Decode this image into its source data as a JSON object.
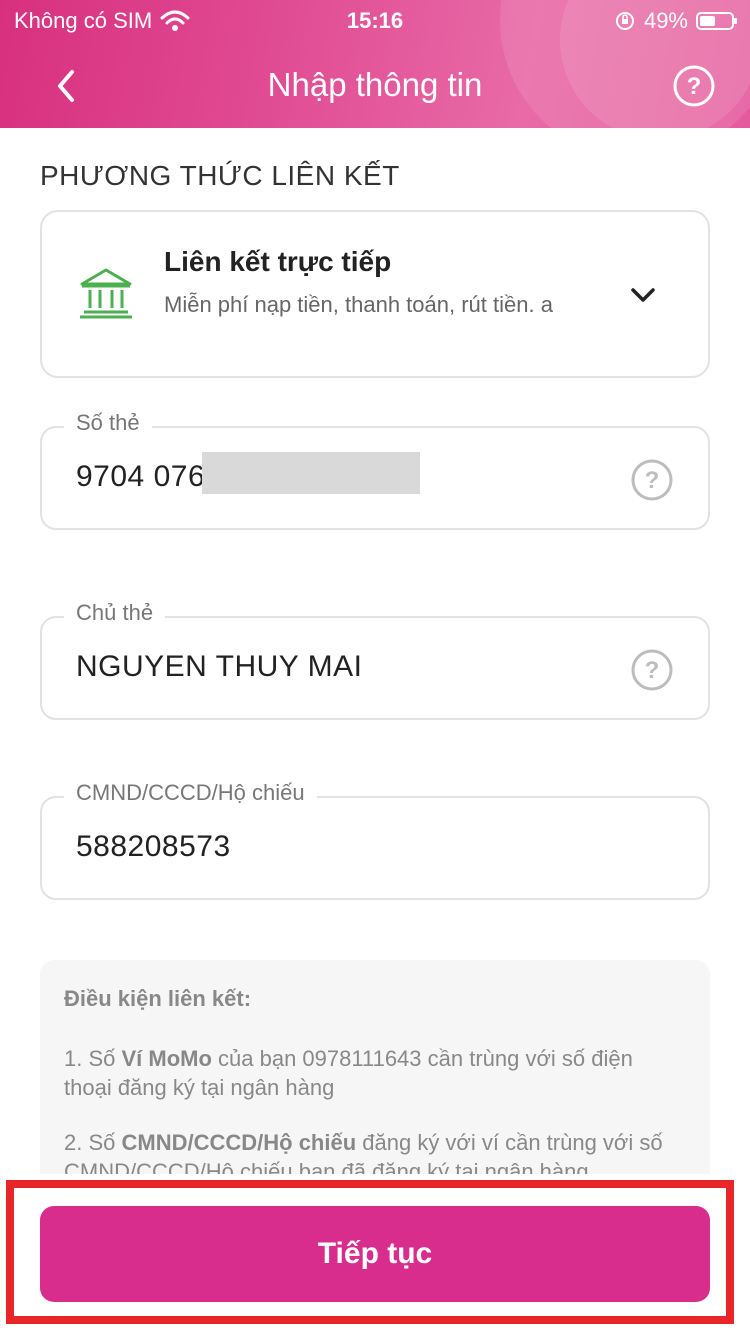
{
  "status_bar": {
    "carrier": "Không có SIM",
    "time": "15:16",
    "battery": "49%",
    "battery_level": 0.49
  },
  "header": {
    "title": "Nhập thông tin",
    "back_icon": "chevron-left-icon",
    "help_icon": "question-circle-icon"
  },
  "link_method": {
    "section_label": "PHƯƠNG THỨC LIÊN KẾT",
    "title": "Liên kết trực tiếp",
    "description": "Miễn phí nạp tiền, thanh toán, rút tiền. a",
    "icon": "bank-icon",
    "accent_color": "#4caf50"
  },
  "fields": {
    "card_number": {
      "label": "Số thẻ",
      "value": "9704 076"
    },
    "card_holder": {
      "label": "Chủ thẻ",
      "value": "NGUYEN THUY MAI"
    },
    "id_number": {
      "label": "CMND/CCCD/Hộ chiếu",
      "value": "588208573"
    }
  },
  "conditions": {
    "title": "Điều kiện liên kết:",
    "item1": {
      "prefix": "1. Số ",
      "bold": "Ví MoMo",
      "rest": " của bạn 0978111643 cần trùng với số điện thoại đăng ký tại ngân hàng"
    },
    "item2": {
      "prefix": "2. Số ",
      "bold": "CMND/CCCD/Hộ chiếu",
      "rest": " đăng ký với ví cần trùng với số CMND/CCCD/Hộ chiếu bạn đã đăng ký tại ngân hàng"
    }
  },
  "footer": {
    "button_label": "Tiếp tục"
  },
  "colors": {
    "brand": "#d82d8c",
    "highlight": "#e8262a"
  }
}
